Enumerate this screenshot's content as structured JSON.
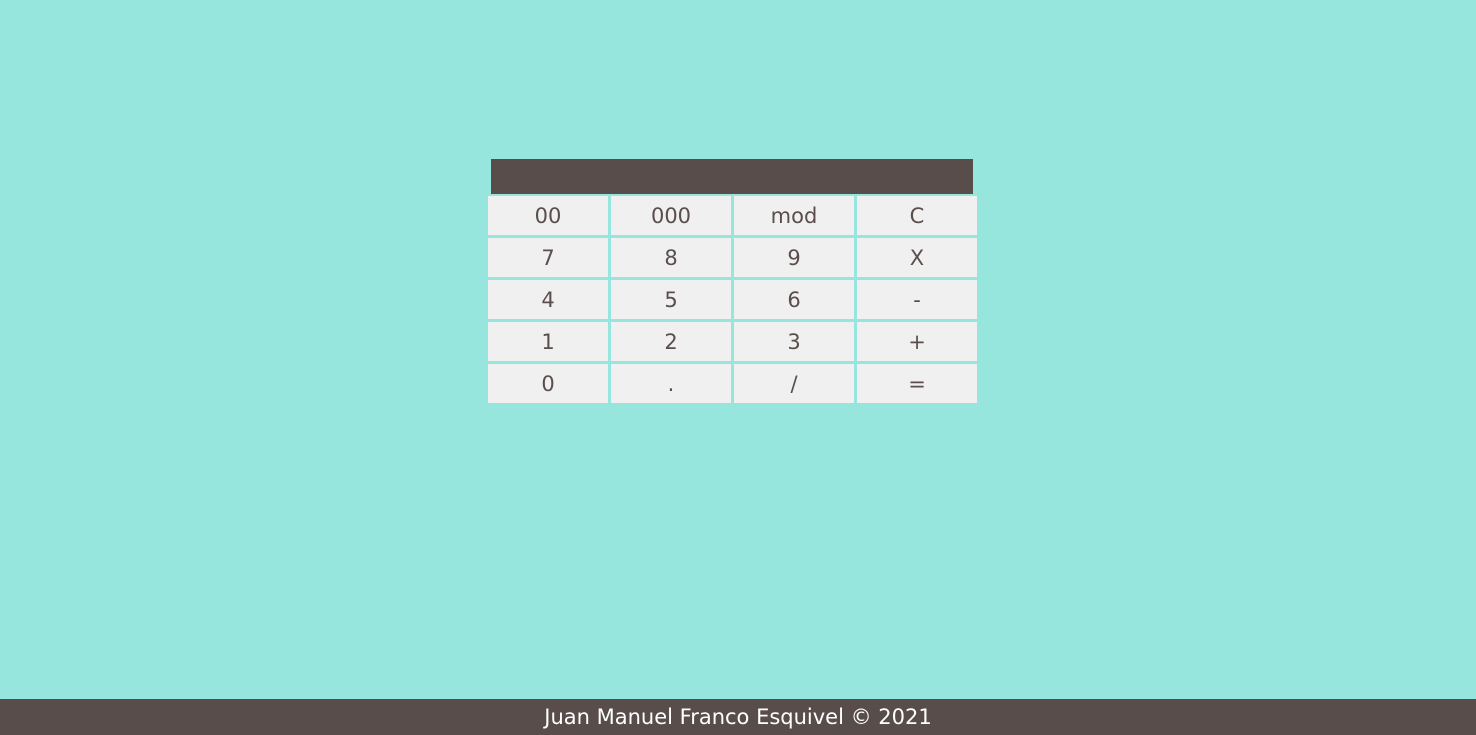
{
  "calculator": {
    "display_value": "",
    "keys": [
      "00",
      "000",
      "mod",
      "C",
      "7",
      "8",
      "9",
      "X",
      "4",
      "5",
      "6",
      "-",
      "1",
      "2",
      "3",
      "+",
      "0",
      ".",
      "/",
      "="
    ]
  },
  "footer": {
    "text": "Juan Manuel Franco Esquivel © 2021"
  },
  "colors": {
    "background": "#96e6de",
    "display": "#584d4b",
    "key_background": "#f0f0f0",
    "key_text": "#5a4e4c",
    "footer_background": "#584d4b",
    "footer_text": "#ffffff"
  }
}
